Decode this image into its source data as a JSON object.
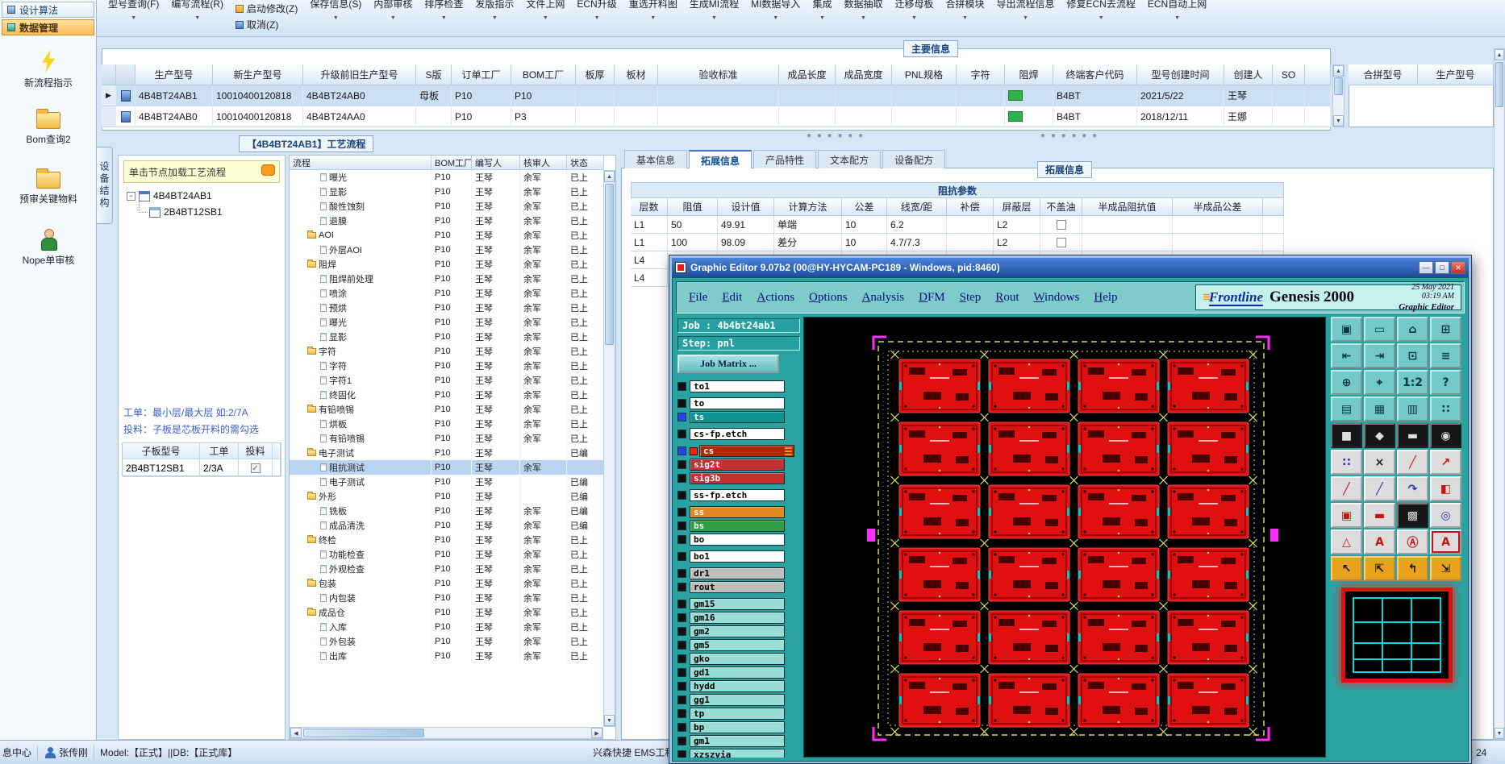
{
  "toolbar": {
    "before": [
      "型号查询(F)",
      "编写流程(R)"
    ],
    "stack": [
      "启动修改(Z)",
      "取消(Z)"
    ],
    "after": [
      "保存信息(S)",
      "内部审核",
      "排序检查",
      "发版指示",
      "文件上网",
      "ECN升级",
      "重选开料图",
      "生成MI流程",
      "MI数据导入",
      "集成",
      "数据抽取",
      "迁移母板",
      "合拼模块",
      "导出流程信息",
      "修复ECN去流程",
      "ECN自动上网"
    ]
  },
  "sidebar": {
    "nav": [
      {
        "label": "设计算法",
        "selected": false
      },
      {
        "label": "数据管理",
        "selected": true
      }
    ],
    "tools": [
      {
        "label": "新流程指示",
        "icon": "lightning-icon"
      },
      {
        "label": "Bom查询2",
        "icon": "folder-icon"
      },
      {
        "label": "预审关键物料",
        "icon": "folder-icon"
      },
      {
        "label": "Nope单审核",
        "icon": "person-icon"
      }
    ]
  },
  "main_grid": {
    "group_title": "主要信息",
    "columns": [
      "生产型号",
      "新生产型号",
      "升级前旧生产型号",
      "S版",
      "订单工厂",
      "BOM工厂",
      "板厚",
      "板材",
      "验收标准",
      "成品长度",
      "成品宽度",
      "PNL规格",
      "字符",
      "阻焊",
      "终端客户代码",
      "型号创建时间",
      "创建人",
      "SO"
    ],
    "right_columns": [
      "合拼型号",
      "生产型号"
    ],
    "solder_mask_color": "#2fb24a",
    "rows": [
      {
        "selected": true,
        "solder_mask": true,
        "cells": [
          "4B4BT24AB1",
          "10010400120818",
          "4B4BT24AB0",
          "母板",
          "P10",
          "P10",
          "",
          "",
          "",
          "",
          "",
          "",
          "",
          "",
          "B4BT",
          "2021/5/22",
          "王琴",
          ""
        ]
      },
      {
        "selected": false,
        "solder_mask": true,
        "cells": [
          "4B4BT24AB0",
          "10010400120818",
          "4B4BT24AA0",
          "",
          "P10",
          "P3",
          "",
          "",
          "",
          "",
          "",
          "",
          "",
          "",
          "B4BT",
          "2018/12/11",
          "王娜",
          ""
        ]
      }
    ]
  },
  "process": {
    "title": "【4B4BT24AB1】工艺流程",
    "vertical_tab": "设备结构",
    "note": "单击节点加载工艺流程",
    "tree_root": "4B4BT24AB1",
    "tree_child": "2B4BT12SB1",
    "hint1": "工单：最小层/最大层 如:2/7A",
    "hint2": "投料：子板是芯板开料的需勾选",
    "subtable": {
      "columns": [
        "子板型号",
        "工单",
        "投料"
      ],
      "row": {
        "model": "2B4BT12SB1",
        "order": "2/3A",
        "feed_checked": true
      }
    }
  },
  "flow": {
    "columns": [
      "流程",
      "BOM工厂",
      "编写人",
      "核审人",
      "状态"
    ],
    "rows": [
      {
        "name": "曝光",
        "type": "leaf",
        "depth": 2,
        "bom": "P10",
        "writer": "王琴",
        "auditor": "余军",
        "status": "已上"
      },
      {
        "name": "显影",
        "type": "leaf",
        "depth": 2,
        "bom": "P10",
        "writer": "王琴",
        "auditor": "余军",
        "status": "已上"
      },
      {
        "name": "酸性蚀刻",
        "type": "leaf",
        "depth": 2,
        "bom": "P10",
        "writer": "王琴",
        "auditor": "余军",
        "status": "已上"
      },
      {
        "name": "退膜",
        "type": "leaf",
        "depth": 2,
        "bom": "P10",
        "writer": "王琴",
        "auditor": "余军",
        "status": "已上"
      },
      {
        "name": "AOI",
        "type": "folder",
        "depth": 1,
        "bom": "P10",
        "writer": "王琴",
        "auditor": "余军",
        "status": "已上"
      },
      {
        "name": "外层AOI",
        "type": "leaf",
        "depth": 2,
        "bom": "P10",
        "writer": "王琴",
        "auditor": "余军",
        "status": "已上"
      },
      {
        "name": "阻焊",
        "type": "folder",
        "depth": 1,
        "bom": "P10",
        "writer": "王琴",
        "auditor": "余军",
        "status": "已上"
      },
      {
        "name": "阻焊前处理",
        "type": "leaf",
        "depth": 2,
        "bom": "P10",
        "writer": "王琴",
        "auditor": "余军",
        "status": "已上"
      },
      {
        "name": "喷涂",
        "type": "leaf",
        "depth": 2,
        "bom": "P10",
        "writer": "王琴",
        "auditor": "余军",
        "status": "已上"
      },
      {
        "name": "预烘",
        "type": "leaf",
        "depth": 2,
        "bom": "P10",
        "writer": "王琴",
        "auditor": "余军",
        "status": "已上"
      },
      {
        "name": "曝光",
        "type": "leaf",
        "depth": 2,
        "bom": "P10",
        "writer": "王琴",
        "auditor": "余军",
        "status": "已上"
      },
      {
        "name": "显影",
        "type": "leaf",
        "depth": 2,
        "bom": "P10",
        "writer": "王琴",
        "auditor": "余军",
        "status": "已上"
      },
      {
        "name": "字符",
        "type": "folder",
        "depth": 1,
        "bom": "P10",
        "writer": "王琴",
        "auditor": "余军",
        "status": "已上"
      },
      {
        "name": "字符",
        "type": "leaf",
        "depth": 2,
        "bom": "P10",
        "writer": "王琴",
        "auditor": "余军",
        "status": "已上"
      },
      {
        "name": "字符1",
        "type": "leaf",
        "depth": 2,
        "bom": "P10",
        "writer": "王琴",
        "auditor": "余军",
        "status": "已上"
      },
      {
        "name": "终固化",
        "type": "leaf",
        "depth": 2,
        "bom": "P10",
        "writer": "王琴",
        "auditor": "余军",
        "status": "已上"
      },
      {
        "name": "有铅喷锡",
        "type": "folder",
        "depth": 1,
        "bom": "P10",
        "writer": "王琴",
        "auditor": "余军",
        "status": "已上"
      },
      {
        "name": "烘板",
        "type": "leaf",
        "depth": 2,
        "bom": "P10",
        "writer": "王琴",
        "auditor": "余军",
        "status": "已上"
      },
      {
        "name": "有铅喷锡",
        "type": "leaf",
        "depth": 2,
        "bom": "P10",
        "writer": "王琴",
        "auditor": "余军",
        "status": "已上"
      },
      {
        "name": "电子测试",
        "type": "folder",
        "depth": 1,
        "bom": "P10",
        "writer": "王琴",
        "auditor": "",
        "status": "已编"
      },
      {
        "name": "阻抗测试",
        "type": "leaf",
        "depth": 2,
        "bom": "P10",
        "writer": "王琴",
        "auditor": "余军",
        "status": "",
        "selected": true
      },
      {
        "name": "电子测试",
        "type": "leaf",
        "depth": 2,
        "bom": "P10",
        "writer": "王琴",
        "auditor": "",
        "status": "已编"
      },
      {
        "name": "外形",
        "type": "folder",
        "depth": 1,
        "bom": "P10",
        "writer": "王琴",
        "auditor": "",
        "status": "已编"
      },
      {
        "name": "铣板",
        "type": "leaf",
        "depth": 2,
        "bom": "P10",
        "writer": "王琴",
        "auditor": "余军",
        "status": "已编"
      },
      {
        "name": "成品清洗",
        "type": "leaf",
        "depth": 2,
        "bom": "P10",
        "writer": "王琴",
        "auditor": "余军",
        "status": "已编"
      },
      {
        "name": "终检",
        "type": "folder",
        "depth": 1,
        "bom": "P10",
        "writer": "王琴",
        "auditor": "余军",
        "status": "已上"
      },
      {
        "name": "功能检查",
        "type": "leaf",
        "depth": 2,
        "bom": "P10",
        "writer": "王琴",
        "auditor": "余军",
        "status": "已上"
      },
      {
        "name": "外观检查",
        "type": "leaf",
        "depth": 2,
        "bom": "P10",
        "writer": "王琴",
        "auditor": "余军",
        "status": "已上"
      },
      {
        "name": "包装",
        "type": "folder",
        "depth": 1,
        "bom": "P10",
        "writer": "王琴",
        "auditor": "余军",
        "status": "已上"
      },
      {
        "name": "内包装",
        "type": "leaf",
        "depth": 2,
        "bom": "P10",
        "writer": "王琴",
        "auditor": "余军",
        "status": "已上"
      },
      {
        "name": "成品仓",
        "type": "folder",
        "depth": 1,
        "bom": "P10",
        "writer": "王琴",
        "auditor": "余军",
        "status": "已上"
      },
      {
        "name": "入库",
        "type": "leaf",
        "depth": 2,
        "bom": "P10",
        "writer": "王琴",
        "auditor": "余军",
        "status": "已上"
      },
      {
        "name": "外包装",
        "type": "leaf",
        "depth": 2,
        "bom": "P10",
        "writer": "王琴",
        "auditor": "余军",
        "status": "已上"
      },
      {
        "name": "出库",
        "type": "leaf",
        "depth": 2,
        "bom": "P10",
        "writer": "王琴",
        "auditor": "余军",
        "status": "已上"
      }
    ]
  },
  "right_panel": {
    "tabs": [
      {
        "label": "基本信息",
        "selected": false
      },
      {
        "label": "拓展信息",
        "selected": true
      },
      {
        "label": "产品特性",
        "selected": false
      },
      {
        "label": "文本配方",
        "selected": false
      },
      {
        "label": "设备配方",
        "selected": false
      }
    ],
    "group_title": "拓展信息",
    "impedance": {
      "title": "阻抗参数",
      "columns": [
        "层数",
        "阻值",
        "设计值",
        "计算方法",
        "公差",
        "线宽/距",
        "补偿",
        "屏蔽层",
        "不盖油",
        "半成品阻抗值",
        "半成品公差"
      ],
      "rows": [
        {
          "layer": "L1",
          "value": "50",
          "design": "49.91",
          "method": "单端",
          "tolerance": "10",
          "width": "6.2",
          "comp": "",
          "shield": "L2",
          "uncovered": false,
          "semi_value": "",
          "semi_tol": ""
        },
        {
          "layer": "L1",
          "value": "100",
          "design": "98.09",
          "method": "差分",
          "tolerance": "10",
          "width": "4.7/7.3",
          "comp": "",
          "shield": "L2",
          "uncovered": false,
          "semi_value": "",
          "semi_tol": ""
        },
        {
          "layer": "L4"
        },
        {
          "layer": "L4"
        }
      ]
    }
  },
  "editor": {
    "title": "Graphic Editor 9.07b2 (00@HY-HYCAM-PC189 - Windows, pid:8460)",
    "menus": [
      "File",
      "Edit",
      "Actions",
      "Options",
      "Analysis",
      "DFM",
      "Step",
      "Rout",
      "Windows",
      "Help"
    ],
    "brand": {
      "logo": "Frontline",
      "product": "Genesis 2000",
      "date": "25 May 2021",
      "time": "03:19 AM",
      "subtitle": "Graphic Editor"
    },
    "job": "Job : 4b4bt24ab1",
    "step": "Step: pnl",
    "matrix": "Job Matrix ...",
    "layers": [
      {
        "name": "to1",
        "bg": "#ffffff",
        "fg": "#000000",
        "cb": "#101010",
        "gap": true
      },
      {
        "name": "to",
        "bg": "#ffffff",
        "fg": "#000000",
        "cb": "#101010"
      },
      {
        "name": "ts",
        "bg": "#0e9390",
        "fg": "#ffffff",
        "cb": "#2244ee",
        "gap": true
      },
      {
        "name": "cs-fp.etch",
        "bg": "#ffffff",
        "fg": "#000000",
        "cb": "#101010",
        "gap": true
      },
      {
        "name": "cs",
        "bg": "#b02800",
        "fg": "#ffffff",
        "cb": "#2244ee",
        "swatch": "#ff2200",
        "grip": true
      },
      {
        "name": "sig2t",
        "bg": "#c23030",
        "fg": "#ffffff",
        "cb": "#101010"
      },
      {
        "name": "sig3b",
        "bg": "#c23030",
        "fg": "#ffffff",
        "cb": "#101010",
        "gap": true
      },
      {
        "name": "ss-fp.etch",
        "bg": "#ffffff",
        "fg": "#000000",
        "cb": "#101010",
        "gap": true
      },
      {
        "name": "ss",
        "bg": "#e08a20",
        "fg": "#ffffff",
        "cb": "#101010"
      },
      {
        "name": "bs",
        "bg": "#2f9e44",
        "fg": "#ffffff",
        "cb": "#101010"
      },
      {
        "name": "bo",
        "bg": "#ffffff",
        "fg": "#000000",
        "cb": "#101010",
        "gap": true
      },
      {
        "name": "bo1",
        "bg": "#ffffff",
        "fg": "#000000",
        "cb": "#101010",
        "gap": true
      },
      {
        "name": "dr1",
        "bg": "#bfbfbf",
        "fg": "#000000",
        "cb": "#101010"
      },
      {
        "name": "rout",
        "bg": "#bfbfbf",
        "fg": "#000000",
        "cb": "#101010",
        "gap": true
      },
      {
        "name": "gm15",
        "bg": "#9adcd6",
        "fg": "#000000",
        "cb": "#101010"
      },
      {
        "name": "gm16",
        "bg": "#9adcd6",
        "fg": "#000000",
        "cb": "#101010"
      },
      {
        "name": "gm2",
        "bg": "#9adcd6",
        "fg": "#000000",
        "cb": "#101010"
      },
      {
        "name": "gm5",
        "bg": "#9adcd6",
        "fg": "#000000",
        "cb": "#101010"
      },
      {
        "name": "gko",
        "bg": "#9adcd6",
        "fg": "#000000",
        "cb": "#101010"
      },
      {
        "name": "gd1",
        "bg": "#9adcd6",
        "fg": "#000000",
        "cb": "#101010"
      },
      {
        "name": "hydd",
        "bg": "#9adcd6",
        "fg": "#000000",
        "cb": "#101010"
      },
      {
        "name": "gg1",
        "bg": "#9adcd6",
        "fg": "#000000",
        "cb": "#101010"
      },
      {
        "name": "tp",
        "bg": "#9adcd6",
        "fg": "#000000",
        "cb": "#101010"
      },
      {
        "name": "bp",
        "bg": "#9adcd6",
        "fg": "#000000",
        "cb": "#101010"
      },
      {
        "name": "gm1",
        "bg": "#9adcd6",
        "fg": "#000000",
        "cb": "#101010"
      },
      {
        "name": "xzszvia",
        "bg": "#9adcd6",
        "fg": "#000000",
        "cb": "#101010"
      }
    ],
    "panel": {
      "cols": 4,
      "rows": 6
    },
    "tools": [
      {
        "name": "clipboard-page-icon",
        "glyph": "▣",
        "cls": "t-teal"
      },
      {
        "name": "display-icon",
        "glyph": "▭",
        "cls": "t-teal"
      },
      {
        "name": "home-icon",
        "glyph": "⌂",
        "cls": "t-teal"
      },
      {
        "name": "tile-windows-icon",
        "glyph": "⊞",
        "cls": "t-teal"
      },
      {
        "name": "pan-left-icon",
        "glyph": "⇤",
        "cls": "t-teal"
      },
      {
        "name": "pan-right-icon",
        "glyph": "⇥",
        "cls": "t-teal"
      },
      {
        "name": "zoom-box-icon",
        "glyph": "⊡",
        "cls": "t-teal"
      },
      {
        "name": "layers-stack-icon",
        "glyph": "≡",
        "cls": "t-teal"
      },
      {
        "name": "zoom-in-icon",
        "glyph": "⊕",
        "cls": "t-teal"
      },
      {
        "name": "zoom-center-icon",
        "glyph": "⌖",
        "cls": "t-teal"
      },
      {
        "name": "zoom-1-2-icon",
        "glyph": "1:2",
        "cls": "t-teal"
      },
      {
        "name": "help-icon",
        "glyph": "?",
        "cls": "t-teal"
      },
      {
        "name": "clipboard-icon",
        "glyph": "▤",
        "cls": "t-teal"
      },
      {
        "name": "grid-icon",
        "glyph": "▦",
        "cls": "t-teal"
      },
      {
        "name": "columns-left-icon",
        "glyph": "▥",
        "cls": "t-teal"
      },
      {
        "name": "dot-matrix-icon",
        "glyph": "∷",
        "cls": "t-teal"
      },
      {
        "name": "filled-rect-icon",
        "glyph": "■",
        "cls": "t-dark"
      },
      {
        "name": "polygon-icon",
        "glyph": "◆",
        "cls": "t-dark"
      },
      {
        "name": "measure-bar-icon",
        "glyph": "▬",
        "cls": "t-dark"
      },
      {
        "name": "target-icon",
        "glyph": "◉",
        "cls": "t-dark"
      },
      {
        "name": "pads-icon",
        "glyph": "∷",
        "cls": "t-lblue"
      },
      {
        "name": "delete-x-icon",
        "glyph": "×",
        "cls": "t-light"
      },
      {
        "name": "line-dot-icon",
        "glyph": "╱",
        "cls": "t-lred"
      },
      {
        "name": "arrow-dot-icon",
        "glyph": "↗",
        "cls": "t-lred"
      },
      {
        "name": "slash-red-icon",
        "glyph": "╱",
        "cls": "t-lred"
      },
      {
        "name": "slash-blue-icon",
        "glyph": "╱",
        "cls": "t-lblue"
      },
      {
        "name": "arc-icon",
        "glyph": "↷",
        "cls": "t-lblue"
      },
      {
        "name": "half-fill-icon",
        "glyph": "◧",
        "cls": "t-lred"
      },
      {
        "name": "move-box-icon",
        "glyph": "▣",
        "cls": "t-lred"
      },
      {
        "name": "subtract-icon",
        "glyph": "▬",
        "cls": "t-lred"
      },
      {
        "name": "hatch-region-icon",
        "glyph": "▩",
        "cls": "t-dark"
      },
      {
        "name": "overlap-circles-icon",
        "glyph": "◎",
        "cls": "t-lblue"
      },
      {
        "name": "triangle-alert-icon",
        "glyph": "△",
        "cls": "t-lred"
      },
      {
        "name": "text-a-icon",
        "glyph": "A",
        "cls": "t-lred"
      },
      {
        "name": "text-a-circle-icon",
        "glyph": "Ⓐ",
        "cls": "t-lred"
      },
      {
        "name": "text-a-box-icon",
        "glyph": "A",
        "cls": "t-lred boxed"
      },
      {
        "name": "cursor-icon",
        "glyph": "↖",
        "cls": "t-yellow"
      },
      {
        "name": "cursor-select-icon",
        "glyph": "⇱",
        "cls": "t-yellow"
      },
      {
        "name": "cursor-branch-icon",
        "glyph": "↰",
        "cls": "t-yellow"
      },
      {
        "name": "cursor-corner-icon",
        "glyph": "⇲",
        "cls": "t-yellow"
      }
    ]
  },
  "statusbar": {
    "left": "息中心",
    "user": "张传刚",
    "model": "Model:【正式】||DB:【正式库】",
    "system": "兴森快捷 EMS工程系统 V",
    "right": "24"
  }
}
